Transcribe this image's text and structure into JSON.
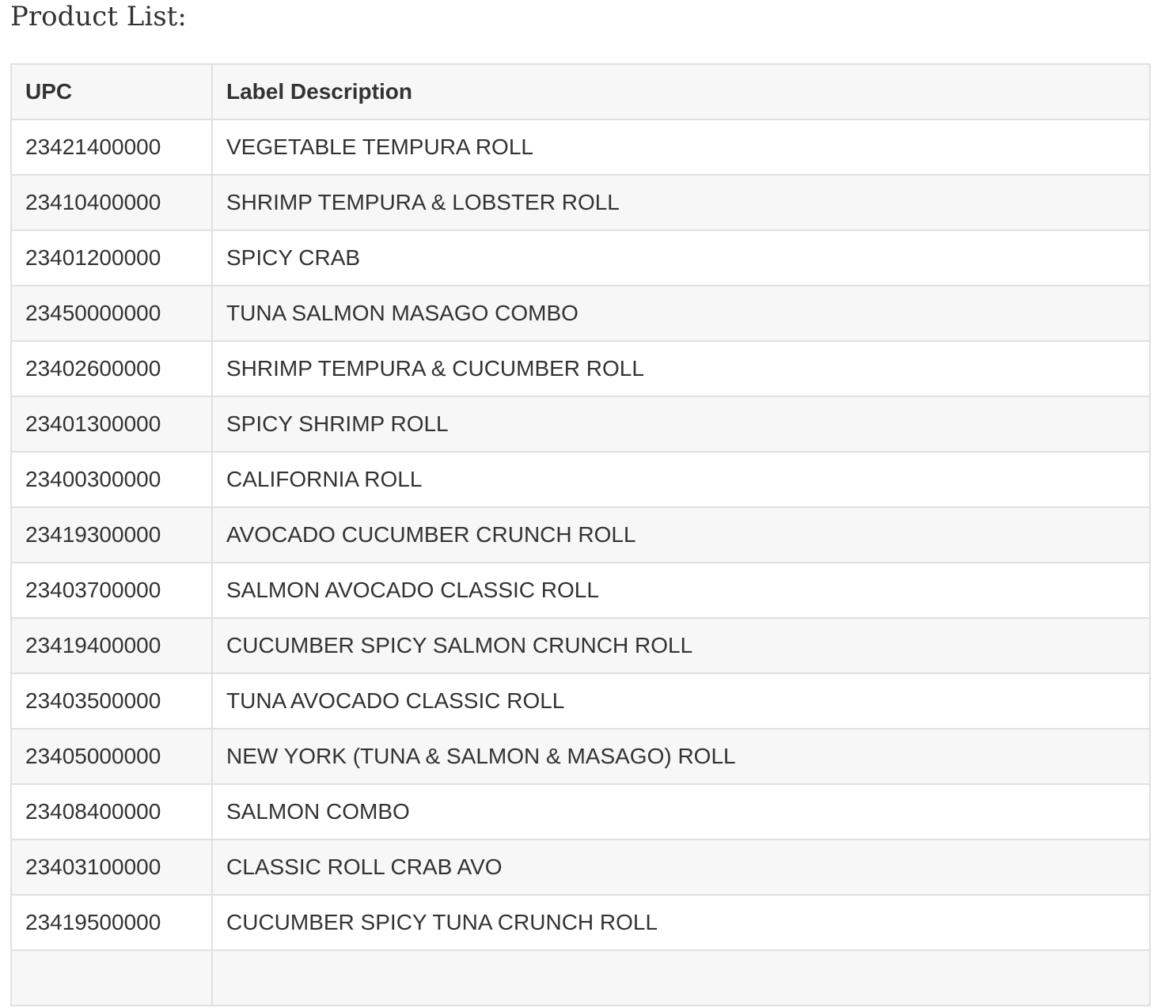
{
  "page": {
    "title": "Product List:"
  },
  "table": {
    "headers": {
      "upc": "UPC",
      "description": "Label Description"
    },
    "rows": [
      {
        "upc": "23421400000",
        "description": "VEGETABLE TEMPURA ROLL"
      },
      {
        "upc": "23410400000",
        "description": "SHRIMP TEMPURA & LOBSTER ROLL"
      },
      {
        "upc": "23401200000",
        "description": "SPICY CRAB"
      },
      {
        "upc": "23450000000",
        "description": "TUNA SALMON MASAGO COMBO"
      },
      {
        "upc": "23402600000",
        "description": "SHRIMP TEMPURA & CUCUMBER ROLL"
      },
      {
        "upc": "23401300000",
        "description": "SPICY SHRIMP ROLL"
      },
      {
        "upc": "23400300000",
        "description": "CALIFORNIA ROLL"
      },
      {
        "upc": "23419300000",
        "description": "AVOCADO CUCUMBER CRUNCH ROLL"
      },
      {
        "upc": "23403700000",
        "description": "SALMON AVOCADO CLASSIC ROLL"
      },
      {
        "upc": "23419400000",
        "description": "CUCUMBER SPICY SALMON CRUNCH ROLL"
      },
      {
        "upc": "23403500000",
        "description": "TUNA AVOCADO CLASSIC ROLL"
      },
      {
        "upc": "23405000000",
        "description": "NEW YORK (TUNA & SALMON & MASAGO) ROLL"
      },
      {
        "upc": "23408400000",
        "description": "SALMON COMBO"
      },
      {
        "upc": "23403100000",
        "description": "CLASSIC ROLL CRAB AVO"
      },
      {
        "upc": "23419500000",
        "description": "CUCUMBER SPICY TUNA CRUNCH ROLL"
      },
      {
        "upc": "",
        "description": ""
      }
    ]
  },
  "colors": {
    "text": "#333333",
    "border": "#e0e0e0",
    "stripe": "#f7f7f7",
    "background": "#ffffff"
  }
}
